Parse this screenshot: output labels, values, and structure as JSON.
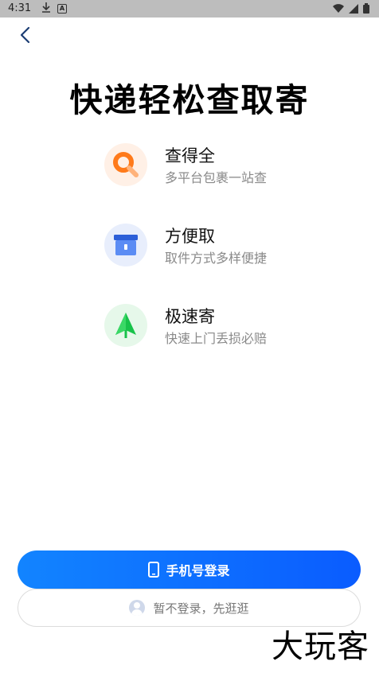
{
  "status_bar": {
    "time": "4:31",
    "download_icon": "download-icon",
    "app_icon": "A"
  },
  "header": {
    "back_icon": "chevron-left-icon"
  },
  "headline": "快递轻松查取寄",
  "features": [
    {
      "title": "查得全",
      "desc": "多平台包裹一站查",
      "icon": "search-icon",
      "color": "#ff7a1a"
    },
    {
      "title": "方便取",
      "desc": "取件方式多样便捷",
      "icon": "locker-icon",
      "color": "#4a7cf0"
    },
    {
      "title": "极速寄",
      "desc": "快速上门丢损必赔",
      "icon": "send-icon",
      "color": "#18c24a"
    }
  ],
  "buttons": {
    "phone_login": "手机号登录",
    "skip_login": "暂不登录，先逛逛"
  },
  "watermark": "大玩客",
  "colors": {
    "primary": "#0a6cff",
    "gray_text": "#8a8a8a"
  }
}
